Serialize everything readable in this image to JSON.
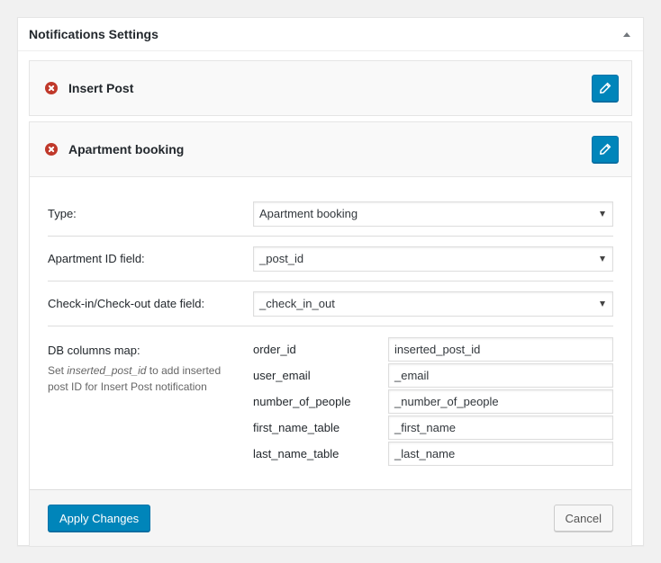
{
  "panel": {
    "title": "Notifications Settings",
    "toggle_icon": "triangle-up-icon"
  },
  "notifications": [
    {
      "title": "Insert Post",
      "delete_icon": "remove-circle-icon",
      "edit_icon": "pencil-icon"
    },
    {
      "title": "Apartment booking",
      "delete_icon": "remove-circle-icon",
      "edit_icon": "pencil-icon"
    }
  ],
  "form": {
    "type_label": "Type:",
    "type_value": "Apartment booking",
    "apartment_id_label": "Apartment ID field:",
    "apartment_id_value": "_post_id",
    "checkin_label": "Check-in/Check-out date field:",
    "checkin_value": "_check_in_out",
    "db_map_label": "DB columns map:",
    "db_map_desc_pre": "Set ",
    "db_map_desc_em": "inserted_post_id",
    "db_map_desc_post": " to add inserted post ID for Insert Post notification",
    "columns": [
      {
        "key": "order_id",
        "value": "inserted_post_id"
      },
      {
        "key": "user_email",
        "value": "_email"
      },
      {
        "key": "number_of_people",
        "value": "_number_of_people"
      },
      {
        "key": "first_name_table",
        "value": "_first_name"
      },
      {
        "key": "last_name_table",
        "value": "_last_name"
      }
    ]
  },
  "footer": {
    "apply_label": "Apply Changes",
    "cancel_label": "Cancel"
  },
  "colors": {
    "primary": "#0085ba",
    "danger": "#c0392b",
    "background": "#f1f1f1"
  }
}
